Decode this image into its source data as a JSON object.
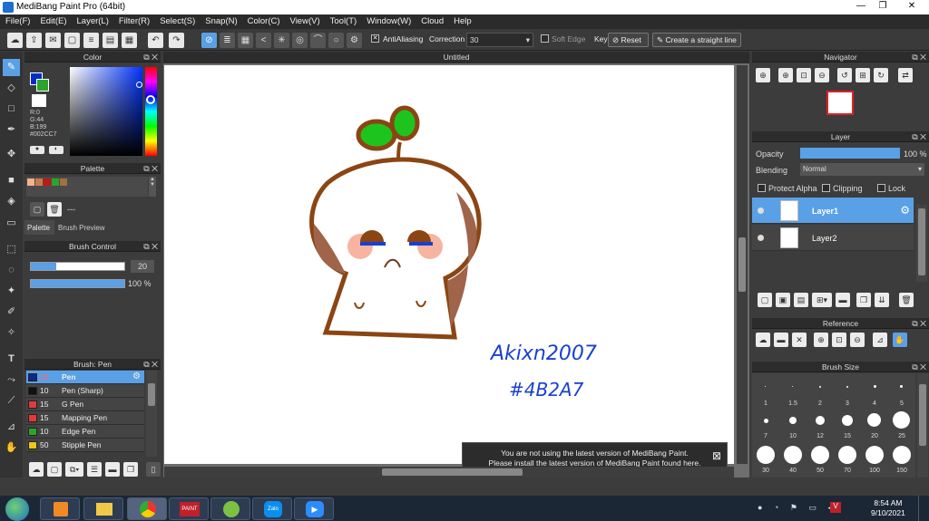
{
  "window": {
    "title": "MediBang Paint Pro (64bit)"
  },
  "menu": [
    "File(F)",
    "Edit(E)",
    "Layer(L)",
    "Filter(R)",
    "Select(S)",
    "Snap(N)",
    "Color(C)",
    "View(V)",
    "Tool(T)",
    "Window(W)",
    "Cloud",
    "Help"
  ],
  "toolbar": {
    "antialiasing_label": "AntiAliasing",
    "correction_label": "Correction",
    "correction_value": "30",
    "soft_edge_label": "Soft Edge",
    "key_label": "Key",
    "reset_label": "Reset",
    "straight_line_label": "Create a straight line"
  },
  "color_panel": {
    "title": "Color",
    "r": "R:0",
    "g": "G:44",
    "b": "B:199",
    "hex": "#002CC7",
    "primary_color": "#002CC7"
  },
  "palette_panel": {
    "title": "Palette",
    "swatches": [
      "#f2b48a",
      "#c9794d",
      "#c01717",
      "#2aa52a",
      "#a0713f"
    ],
    "name": "---",
    "tabs": [
      "Palette",
      "Brush Preview"
    ]
  },
  "brush_control": {
    "title": "Brush Control",
    "size_value": "20",
    "size_fraction": 0.27,
    "opacity_value": "100 %",
    "opacity_fraction": 1.0
  },
  "brush_panel": {
    "title": "Brush: Pen",
    "brushes": [
      {
        "size": "20",
        "name": "Pen",
        "color": "#0b2a8a"
      },
      {
        "size": "10",
        "name": "Pen (Sharp)",
        "color": "#111111"
      },
      {
        "size": "15",
        "name": "G Pen",
        "color": "#e23a3a"
      },
      {
        "size": "15",
        "name": "Mapping Pen",
        "color": "#e23a3a"
      },
      {
        "size": "10",
        "name": "Edge Pen",
        "color": "#2aa52a"
      },
      {
        "size": "50",
        "name": "Stipple Pen",
        "color": "#f0c419"
      }
    ]
  },
  "canvas": {
    "tab_title": "Untitled",
    "signature_line1": "Akixn2007",
    "signature_line2": "#4B2A7",
    "notice_line1": "You are not using the latest version of MediBang Paint.",
    "notice_line2": "Please install the latest version of MediBang Paint found here.",
    "notice_close": "⊠"
  },
  "navigator": {
    "title": "Navigator"
  },
  "layer_panel": {
    "title": "Layer",
    "opacity_label": "Opacity",
    "opacity_value": "100 %",
    "opacity_fraction": 1.0,
    "blending_label": "Blending",
    "blending_value": "Normal",
    "protect_alpha_label": "Protect Alpha",
    "clipping_label": "Clipping",
    "lock_label": "Lock",
    "layers": [
      {
        "name": "Layer1",
        "selected": true
      },
      {
        "name": "Layer2",
        "selected": false
      }
    ]
  },
  "reference_panel": {
    "title": "Reference"
  },
  "brush_size_panel": {
    "title": "Brush Size",
    "sizes_row1": [
      "1",
      "1.5",
      "2",
      "3",
      "4",
      "5"
    ],
    "sizes_row2": [
      "7",
      "10",
      "12",
      "15",
      "20",
      "25"
    ],
    "sizes_row3": [
      "30",
      "40",
      "50",
      "70",
      "100",
      "150"
    ]
  },
  "taskbar": {
    "time": "8:54 AM",
    "date": "9/10/2021",
    "apps": [
      "Windows Media Player",
      "File Explorer",
      "Google Chrome",
      "Paint",
      "CCleaner",
      "Zalo",
      "Zoom"
    ]
  }
}
